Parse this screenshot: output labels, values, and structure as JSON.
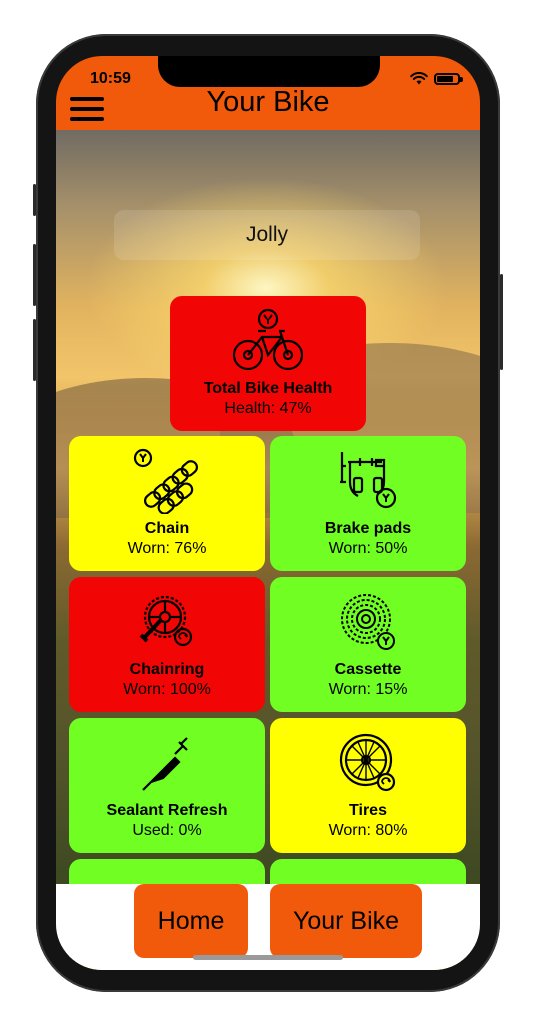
{
  "status_bar": {
    "time": "10:59"
  },
  "header": {
    "title": "Your Bike"
  },
  "bike": {
    "name": "Jolly"
  },
  "total": {
    "name": "Total Bike Health",
    "status": "Health: 47%",
    "color": "#f20505"
  },
  "components": [
    {
      "name": "Chain",
      "status": "Worn: 76%",
      "color": "#ffff00",
      "icon": "chain-icon"
    },
    {
      "name": "Brake pads",
      "status": "Worn: 50%",
      "color": "#70fe23",
      "icon": "brake-pads-icon"
    },
    {
      "name": "Chainring",
      "status": "Worn: 100%",
      "color": "#f20505",
      "icon": "chainring-icon"
    },
    {
      "name": "Cassette",
      "status": "Worn: 15%",
      "color": "#70fe23",
      "icon": "cassette-icon"
    },
    {
      "name": "Sealant Refresh",
      "status": "Used: 0%",
      "color": "#70fe23",
      "icon": "syringe-icon"
    },
    {
      "name": "Tires",
      "status": "Worn: 80%",
      "color": "#ffff00",
      "icon": "tire-icon"
    },
    {
      "name": "",
      "status": "",
      "color": "#70fe23",
      "icon": "brake-lever-icon"
    },
    {
      "name": "",
      "status": "",
      "color": "#70fe23",
      "icon": "wheel-icon"
    }
  ],
  "nav": {
    "home_label": "Home",
    "your_bike_label": "Your Bike"
  },
  "colors": {
    "accent": "#f05a0a",
    "good": "#70fe23",
    "warn": "#ffff00",
    "bad": "#f20505"
  }
}
